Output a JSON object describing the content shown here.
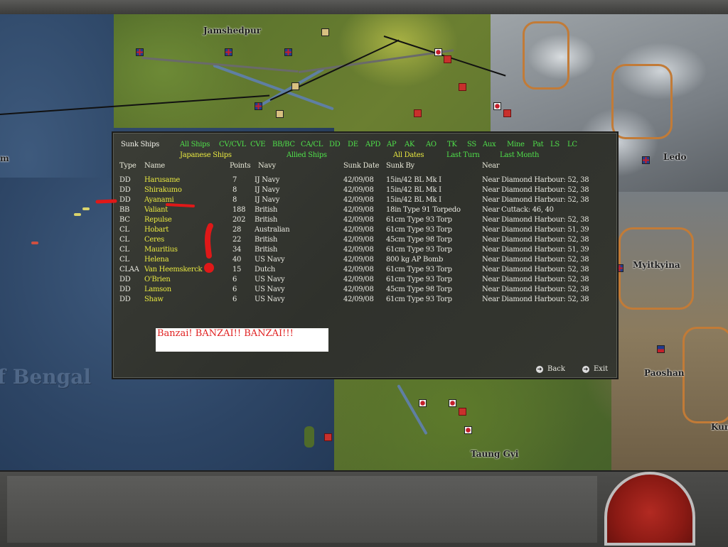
{
  "map": {
    "cities": [
      {
        "id": "jamshedpur",
        "label": "Jamshedpur"
      },
      {
        "id": "ledo",
        "label": "Ledo"
      },
      {
        "id": "myitkyina",
        "label": "Myitkyina"
      },
      {
        "id": "paoshan",
        "label": "Paoshan"
      },
      {
        "id": "taung_gyi",
        "label": "Taung Gyi"
      },
      {
        "id": "kun",
        "label": "Kun"
      },
      {
        "id": "m",
        "label": "m"
      }
    ],
    "region_label": "f Bengal"
  },
  "panel": {
    "title": "Sunk Ships",
    "filters_row1": [
      "All Ships",
      "CV/CVL",
      "CVE",
      "BB/BC",
      "CA/CL",
      "DD",
      "DE",
      "APD",
      "AP",
      "AK",
      "AO",
      "TK",
      "SS",
      "Aux",
      "Mine",
      "Pat",
      "LS",
      "LC"
    ],
    "filters_row2": {
      "japanese_ships": "Japanese Ships",
      "allied_ships": "Allied Ships",
      "all_dates": "All Dates",
      "last_turn": "Last Turn",
      "last_month": "Last Month"
    },
    "columns": {
      "type": "Type",
      "name": "Name",
      "points": "Points",
      "navy": "Navy",
      "sunk_date": "Sunk Date",
      "sunk_by": "Sunk By",
      "near": "Near"
    },
    "rows": [
      {
        "type": "DD",
        "name": "Harusame",
        "points": "7",
        "navy": "IJ Navy",
        "date": "42/09/08",
        "by": "15in/42 BL Mk I",
        "near": "Near Diamond Harbour: 52, 38"
      },
      {
        "type": "DD",
        "name": "Shirakumo",
        "points": "8",
        "navy": "IJ Navy",
        "date": "42/09/08",
        "by": "15in/42 BL Mk I",
        "near": "Near Diamond Harbour: 52, 38"
      },
      {
        "type": "DD",
        "name": "Ayanami",
        "points": "8",
        "navy": "IJ Navy",
        "date": "42/09/08",
        "by": "15in/42 BL Mk I",
        "near": "Near Diamond Harbour: 52, 38"
      },
      {
        "type": "BB",
        "name": "Valiant",
        "points": "188",
        "navy": "British",
        "date": "42/09/08",
        "by": "18in Type 91 Torpedo",
        "near": "Near Cuttack: 46, 40"
      },
      {
        "type": "BC",
        "name": "Repulse",
        "points": "202",
        "navy": "British",
        "date": "42/09/08",
        "by": "61cm Type 93 Torp",
        "near": "Near Diamond Harbour: 52, 38"
      },
      {
        "type": "CL",
        "name": "Hobart",
        "points": "28",
        "navy": "Australian",
        "date": "42/09/08",
        "by": "61cm Type 93 Torp",
        "near": "Near Diamond Harbour: 51, 39"
      },
      {
        "type": "CL",
        "name": "Ceres",
        "points": "22",
        "navy": "British",
        "date": "42/09/08",
        "by": "45cm Type 98 Torp",
        "near": "Near Diamond Harbour: 52, 38"
      },
      {
        "type": "CL",
        "name": "Mauritius",
        "points": "34",
        "navy": "British",
        "date": "42/09/08",
        "by": "61cm Type 93 Torp",
        "near": "Near Diamond Harbour: 51, 39"
      },
      {
        "type": "CL",
        "name": "Helena",
        "points": "40",
        "navy": "US Navy",
        "date": "42/09/08",
        "by": "800 kg AP Bomb",
        "near": "Near Diamond Harbour: 52, 38"
      },
      {
        "type": "CLAA",
        "name": "Van Heemskerck",
        "points": "15",
        "navy": "Dutch",
        "date": "42/09/08",
        "by": "61cm Type 93 Torp",
        "near": "Near Diamond Harbour: 52, 38"
      },
      {
        "type": "DD",
        "name": "O'Brien",
        "points": "6",
        "navy": "US Navy",
        "date": "42/09/08",
        "by": "61cm Type 93 Torp",
        "near": "Near Diamond Harbour: 52, 38"
      },
      {
        "type": "DD",
        "name": "Lamson",
        "points": "6",
        "navy": "US Navy",
        "date": "42/09/08",
        "by": "45cm Type 98 Torp",
        "near": "Near Diamond Harbour: 52, 38"
      },
      {
        "type": "DD",
        "name": "Shaw",
        "points": "6",
        "navy": "US Navy",
        "date": "42/09/08",
        "by": "61cm Type 93 Torp",
        "near": "Near Diamond Harbour: 52, 38"
      }
    ],
    "banzai_text": "Banzai!  BANZAI!!  BANZAI!!!",
    "back_label": "Back",
    "exit_label": "Exit"
  },
  "colors": {
    "filter_active": "#4fe04a",
    "filter_secondary": "#e8e840",
    "ship_name": "#e8e840",
    "annotation_red": "#e01818",
    "coast_border": "#c27b37"
  }
}
